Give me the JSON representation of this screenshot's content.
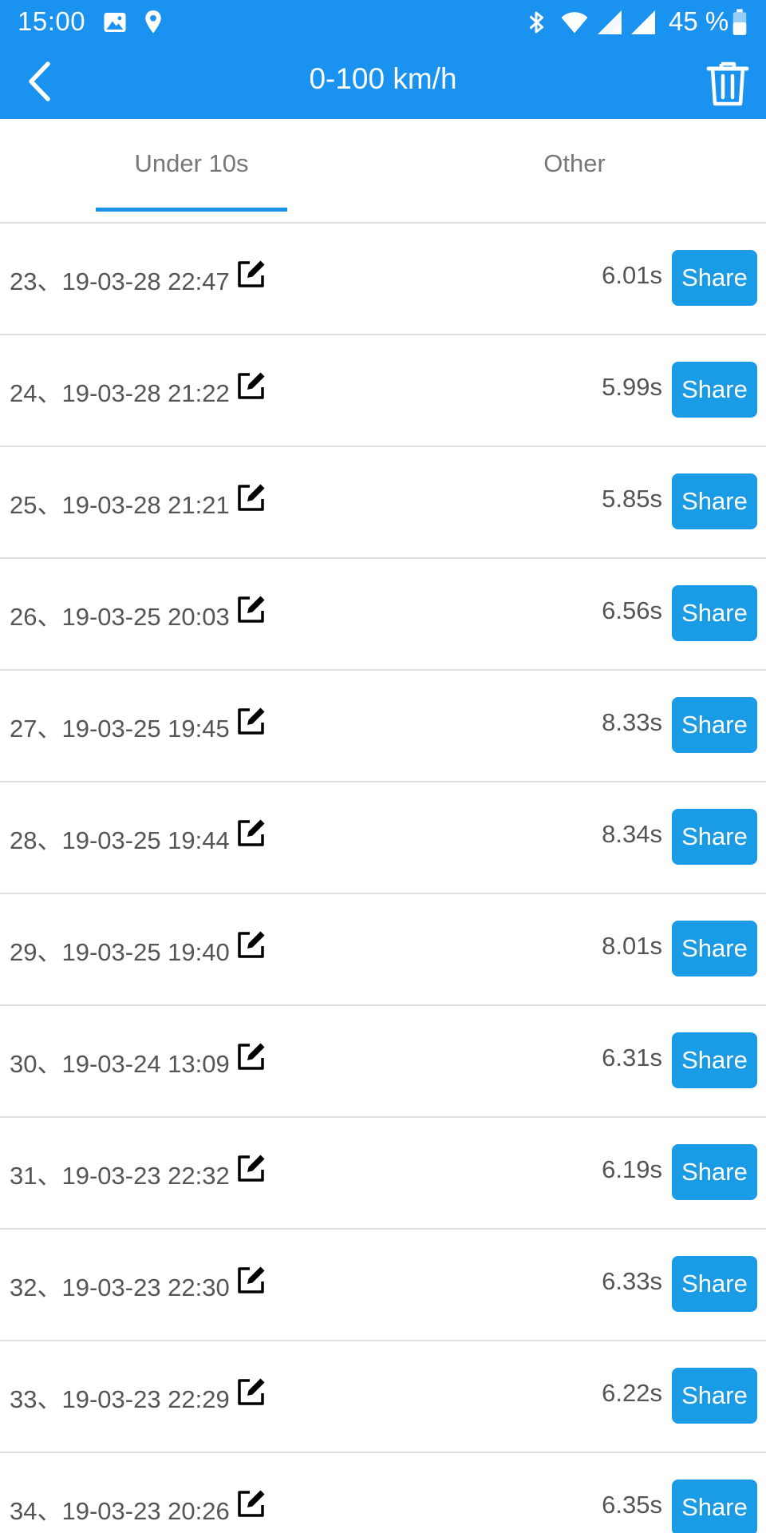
{
  "status_bar": {
    "time": "15:00",
    "battery_percent": "45 %",
    "left_icons": [
      "image-icon",
      "location-pin-icon"
    ],
    "right_icons": [
      "bluetooth-icon",
      "wifi-icon",
      "signal-icon",
      "signal-icon",
      "battery-icon"
    ]
  },
  "app_bar": {
    "title": "0-100 km/h",
    "back_icon": "chevron-left-icon",
    "delete_icon": "trash-icon"
  },
  "tabs": [
    {
      "label": "Under 10s",
      "active": true
    },
    {
      "label": "Other",
      "active": false
    }
  ],
  "list": {
    "share_label": "Share",
    "rows": [
      {
        "label": "23、19-03-28 22:47",
        "time": "6.01s"
      },
      {
        "label": "24、19-03-28 21:22",
        "time": "5.99s"
      },
      {
        "label": "25、19-03-28 21:21",
        "time": "5.85s"
      },
      {
        "label": "26、19-03-25 20:03",
        "time": "6.56s"
      },
      {
        "label": "27、19-03-25 19:45",
        "time": "8.33s"
      },
      {
        "label": "28、19-03-25 19:44",
        "time": "8.34s"
      },
      {
        "label": "29、19-03-25 19:40",
        "time": "8.01s"
      },
      {
        "label": "30、19-03-24 13:09",
        "time": "6.31s"
      },
      {
        "label": "31、19-03-23 22:32",
        "time": "6.19s"
      },
      {
        "label": "32、19-03-23 22:30",
        "time": "6.33s"
      },
      {
        "label": "33、19-03-23 22:29",
        "time": "6.22s"
      },
      {
        "label": "34、19-03-23 20:26",
        "time": "6.35s"
      }
    ]
  },
  "colors": {
    "primary": "#1a92f0",
    "share_button": "#1a9be6",
    "tab_indicator": "#1a92e6",
    "text_secondary": "#555555"
  }
}
